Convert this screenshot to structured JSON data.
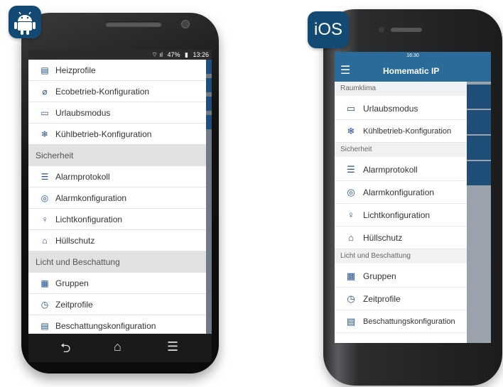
{
  "badges": {
    "ios_label": "iOS"
  },
  "android": {
    "status": {
      "battery": "47%",
      "time": "13:26"
    },
    "menu": [
      {
        "type": "item",
        "icon": "heat-profile-icon",
        "glyph": "▤",
        "label": "Heizprofile"
      },
      {
        "type": "item",
        "icon": "eco-leaf-icon",
        "glyph": "⌀",
        "label": "Ecobetrieb-Konfiguration"
      },
      {
        "type": "item",
        "icon": "holiday-icon",
        "glyph": "▭",
        "label": "Urlaubsmodus"
      },
      {
        "type": "item",
        "icon": "snowflake-icon",
        "glyph": "❄",
        "label": "Kühlbetrieb-Konfiguration"
      },
      {
        "type": "section",
        "label": "Sicherheit"
      },
      {
        "type": "item",
        "icon": "list-icon",
        "glyph": "☰",
        "label": "Alarmprotokoll"
      },
      {
        "type": "item",
        "icon": "alarm-config-icon",
        "glyph": "◎",
        "label": "Alarmkonfiguration"
      },
      {
        "type": "item",
        "icon": "bulb-icon",
        "glyph": "♀",
        "label": "Lichtkonfiguration"
      },
      {
        "type": "item",
        "icon": "house-icon",
        "glyph": "⌂",
        "label": "Hüllschutz"
      },
      {
        "type": "section",
        "label": "Licht und Beschattung"
      },
      {
        "type": "item",
        "icon": "groups-icon",
        "glyph": "▦",
        "label": "Gruppen"
      },
      {
        "type": "item",
        "icon": "time-profile-icon",
        "glyph": "◷",
        "label": "Zeitprofile"
      },
      {
        "type": "item",
        "icon": "shading-icon",
        "glyph": "▤",
        "label": "Beschattungskonfiguration"
      }
    ]
  },
  "ios": {
    "status": {
      "time": "16:30"
    },
    "title": "Homematic IP",
    "menu": [
      {
        "type": "section",
        "label": "Raumklima"
      },
      {
        "type": "item",
        "icon": "holiday-icon",
        "glyph": "▭",
        "label": "Urlaubsmodus"
      },
      {
        "type": "item",
        "icon": "snowflake-icon",
        "glyph": "❄",
        "label": "Kühlbetrieb-Konfiguration",
        "small": true
      },
      {
        "type": "section",
        "label": "Sicherheit"
      },
      {
        "type": "item",
        "icon": "list-icon",
        "glyph": "☰",
        "label": "Alarmprotokoll"
      },
      {
        "type": "item",
        "icon": "alarm-config-icon",
        "glyph": "◎",
        "label": "Alarmkonfiguration"
      },
      {
        "type": "item",
        "icon": "bulb-icon",
        "glyph": "♀",
        "label": "Lichtkonfiguration"
      },
      {
        "type": "item",
        "icon": "house-icon",
        "glyph": "⌂",
        "label": "Hüllschutz"
      },
      {
        "type": "section",
        "label": "Licht und Beschattung"
      },
      {
        "type": "item",
        "icon": "groups-icon",
        "glyph": "▦",
        "label": "Gruppen"
      },
      {
        "type": "item",
        "icon": "time-profile-icon",
        "glyph": "◷",
        "label": "Zeitprofile"
      },
      {
        "type": "item",
        "icon": "shading-icon",
        "glyph": "▤",
        "label": "Beschattungskonfiguration",
        "small": true
      }
    ]
  },
  "colors": {
    "brand": "#124a74",
    "ios_header": "#2a6b9a",
    "section_bg": "#dfe1e3"
  }
}
